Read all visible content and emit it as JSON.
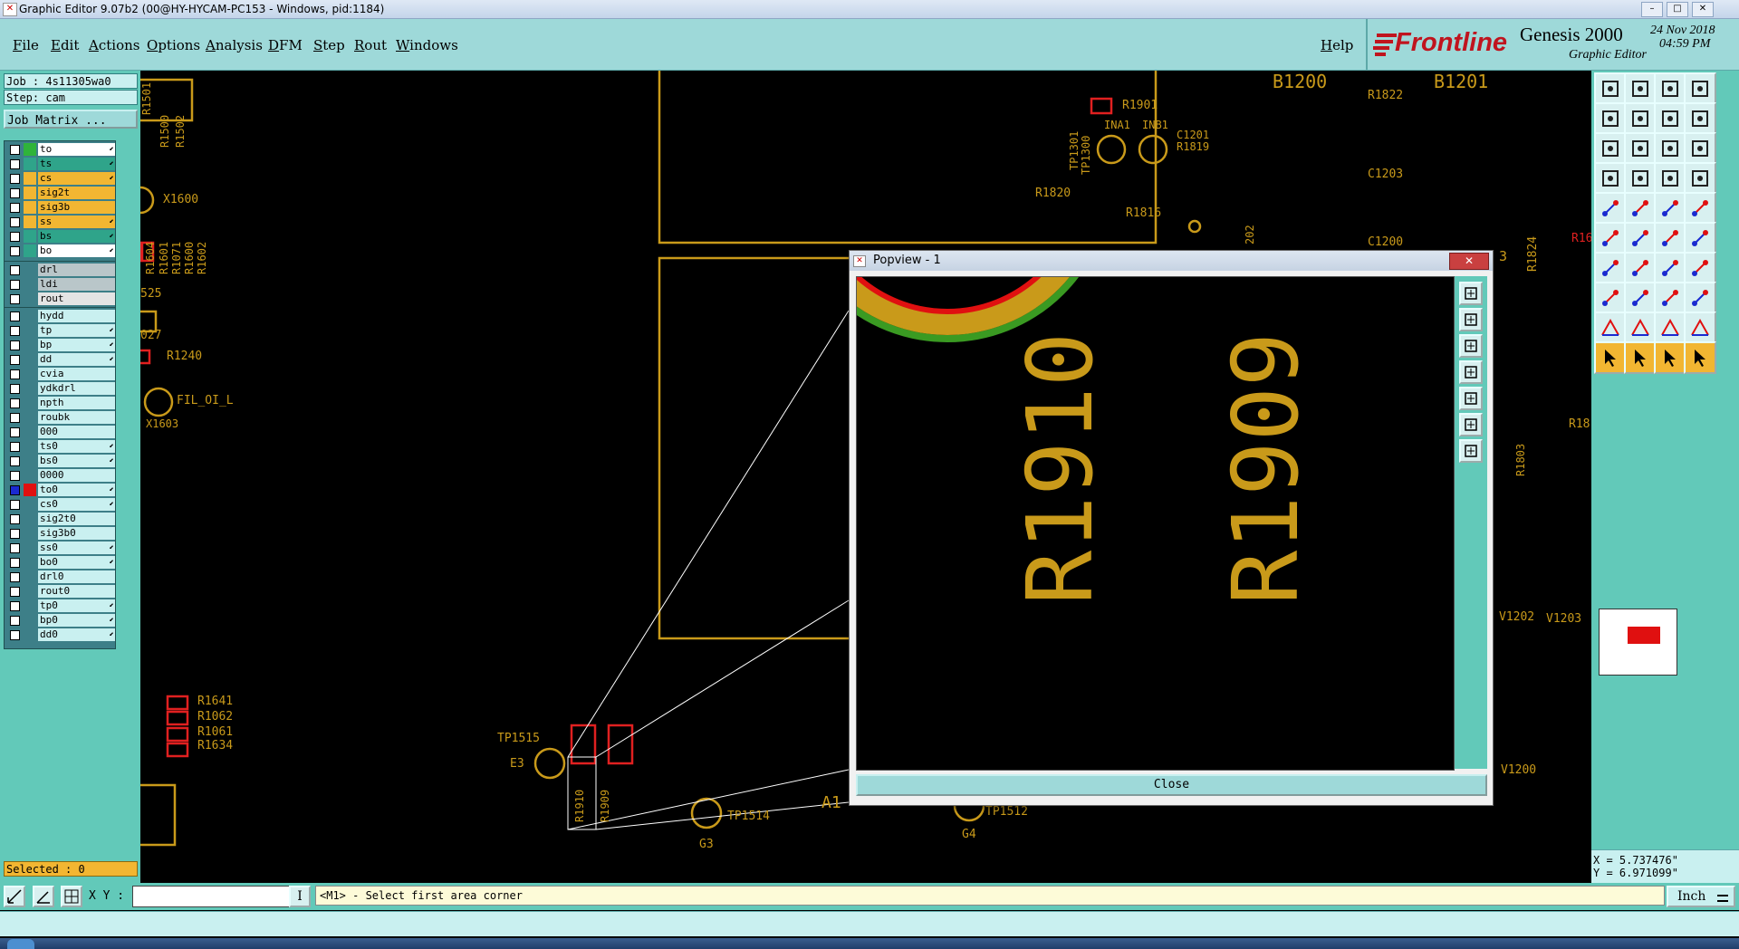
{
  "window": {
    "title": "Graphic Editor 9.07b2 (00@HY-HYCAM-PC153 - Windows, pid:1184)"
  },
  "menu": [
    "File",
    "Edit",
    "Actions",
    "Options",
    "Analysis",
    "DFM",
    "Step",
    "Rout",
    "Windows"
  ],
  "help": "Help",
  "logo": {
    "brand": "Frontline",
    "product": "Genesis 2000",
    "subtitle": "Graphic Editor",
    "date": "24 Nov 2018",
    "time": "04:59 PM"
  },
  "job": {
    "job": "Job : 4s11305wa0",
    "step": "Step: cam",
    "matrix_button": "Job Matrix ..."
  },
  "layers_group1": [
    {
      "name": "to",
      "color": "#ffffff",
      "swatch": "#2fb43a",
      "arrow": true
    },
    {
      "name": "ts",
      "color": "#2fa48a",
      "swatch": "#2fa48a",
      "arrow": true
    },
    {
      "name": "cs",
      "color": "#f2b632",
      "swatch": "#f2b632",
      "arrow": true
    },
    {
      "name": "sig2t",
      "color": "#f2b632",
      "swatch": "#f2b632",
      "arrow": false
    },
    {
      "name": "sig3b",
      "color": "#f2b632",
      "swatch": "#f2b632",
      "arrow": false
    },
    {
      "name": "ss",
      "color": "#f2b632",
      "swatch": "#f2b632",
      "arrow": true
    },
    {
      "name": "bs",
      "color": "#2fa48a",
      "swatch": "#2fa48a",
      "arrow": true
    },
    {
      "name": "bo",
      "color": "#ffffff",
      "swatch": "#2fa48a",
      "arrow": true
    }
  ],
  "layers_group2": [
    {
      "name": "drl",
      "color": "#b9c6c9",
      "arrow": false
    },
    {
      "name": "ldi",
      "color": "#b9c6c9",
      "arrow": false
    },
    {
      "name": "rout",
      "color": "#e4e4e4",
      "arrow": false
    }
  ],
  "layers_group3": [
    {
      "name": "hydd",
      "arrow": false
    },
    {
      "name": "tp",
      "arrow": true
    },
    {
      "name": "bp",
      "arrow": true
    },
    {
      "name": "dd",
      "arrow": true
    },
    {
      "name": "cvia",
      "arrow": false
    },
    {
      "name": "ydkdrl",
      "arrow": false
    },
    {
      "name": "npth",
      "arrow": false
    },
    {
      "name": "roubk",
      "arrow": false
    },
    {
      "name": "000",
      "arrow": false
    },
    {
      "name": "ts0",
      "arrow": true
    },
    {
      "name": "bs0",
      "arrow": true
    },
    {
      "name": "0000",
      "arrow": false
    },
    {
      "name": "to0",
      "arrow": true,
      "selected": true
    },
    {
      "name": "cs0",
      "arrow": true
    },
    {
      "name": "sig2t0",
      "arrow": false
    },
    {
      "name": "sig3b0",
      "arrow": false
    },
    {
      "name": "ss0",
      "arrow": true
    },
    {
      "name": "bo0",
      "arrow": true
    },
    {
      "name": "drl0",
      "arrow": false
    },
    {
      "name": "rout0",
      "arrow": false
    },
    {
      "name": "tp0",
      "arrow": true
    },
    {
      "name": "bp0",
      "arrow": true
    },
    {
      "name": "dd0",
      "arrow": true
    }
  ],
  "selected": "Selected : 0",
  "canvas_labels": {
    "b1200": "B1200",
    "b1201": "B1201",
    "r1822": "R1822",
    "r1901": "R1901",
    "ina1": "INA1",
    "inb1": "INB1",
    "c1201": "C1201",
    "r1819": "R1819",
    "tp1301": "TP1301",
    "tp1300": "TP1300",
    "c1203": "C1203",
    "r1820": "R1820",
    "r1816": "R1816",
    "c1200": "C1200",
    "n202": "202",
    "r1824": "R1824",
    "x1600": "X1600",
    "r1501": "R1501",
    "r1500": "R1500",
    "r1502": "R1502",
    "r1604": "R1604",
    "r1601": "R1601",
    "r1071": "R1071",
    "r1600": "R1600",
    "r1602": "R1602",
    "n525": "525",
    "n027": "027",
    "r1240": "R1240",
    "fil": "FIL_OI_L",
    "x1603": "X1603",
    "r1641": "R1641",
    "r1062": "R1062",
    "r1061": "R1061",
    "r1634": "R1634",
    "tp1515": "TP1515",
    "e3": "E3",
    "r1910": "R1910",
    "r1909": "R1909",
    "tp1514": "TP1514",
    "g3": "G3",
    "a1": "A1",
    "g4": "G4",
    "tp1512": "TP1512",
    "v1202": "V1202",
    "v1203": "V1203",
    "v1200": "V1200",
    "r1803": "R1803",
    "r18a": "R18",
    "r16": "R16",
    "n3": "3"
  },
  "popview": {
    "title": "Popview - 1",
    "label_left": "R1910",
    "label_right": "R1909",
    "close": "Close"
  },
  "coords": {
    "x": "X = 5.737476\"",
    "y": "Y = 6.971099\""
  },
  "status": {
    "xy_label": "X Y :",
    "message": "<M1> - Select first area corner",
    "unit": "Inch"
  }
}
